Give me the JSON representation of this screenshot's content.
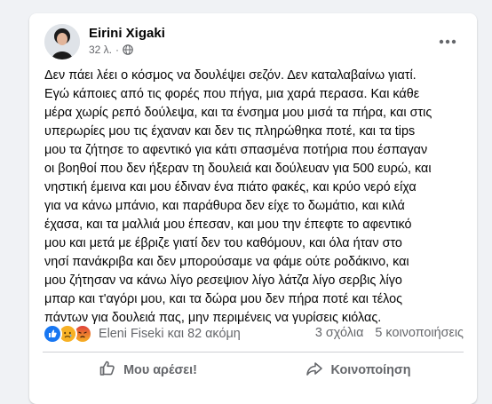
{
  "post": {
    "author": "Eirini Xigaki",
    "time": "32 λ.",
    "visibility_icon": "globe-icon",
    "more_icon": "more-options-icon",
    "text_lines": [
      "Δεν πάει λέει ο κόσμος να δουλέψει σεζόν. Δεν καταλαβαίνω γιατί.",
      "Εγώ κάποιες από τις φορές που πήγα, μια χαρά περασα. Και κάθε",
      "μέρα χωρίς ρεπό δούλεψα, και τα ένσημα μου μισά τα πήρα, και στις",
      "υπερωρίες μου τις έχαναν και δεν τις πληρώθηκα ποτέ, και τα tips",
      "μου τα ζήτησε το αφεντικό για κάτι σπασμένα ποτήρια που έσπαγαν",
      "οι βοηθοί που δεν ήξεραν τη δουλειά και δούλευαν για 500 ευρώ, και",
      "νηστική έμεινα και μου έδιναν ένα πιάτο φακές, και κρύο νερό είχα",
      "για να κάνω μπάνιο, και παράθυρα δεν είχε το δωμάτιο, και κιλά",
      "έχασα, και τα μαλλιά μου έπεσαν, και μου την έπεφτε το αφεντικό",
      "μου και μετά με έβριζε γιατί δεν του καθόμουν, και όλα ήταν στο",
      "νησί πανάκριβα και δεν μπορούσαμε να φάμε ούτε ροδάκινο, και",
      "μου ζήτησαν να κάνω λίγο ρεσεψιον λίγο λάτζα λίγο σερβις λίγο",
      "μπαρ και τ'αγόρι μου, και τα δώρα μου δεν πήρα ποτέ και τέλος",
      "πάντων για δουλειά πας, μην περιμένεις να γυρίσεις κιόλας."
    ]
  },
  "reactions": {
    "icons": [
      "like-reaction-icon",
      "sad-reaction-icon",
      "angry-reaction-icon"
    ],
    "summary": "Eleni Fiseki και 82 ακόμη",
    "comments": "3 σχόλια",
    "shares": "5 κοινοποιήσεις"
  },
  "actions": {
    "like_label": "Μου αρέσει!",
    "share_label": "Κοινοποίηση"
  },
  "colors": {
    "like_blue": "#1877f2",
    "sad_yellow": "#f7b125",
    "angry_orange": "#e9710f",
    "secondary_text": "#65676b"
  }
}
